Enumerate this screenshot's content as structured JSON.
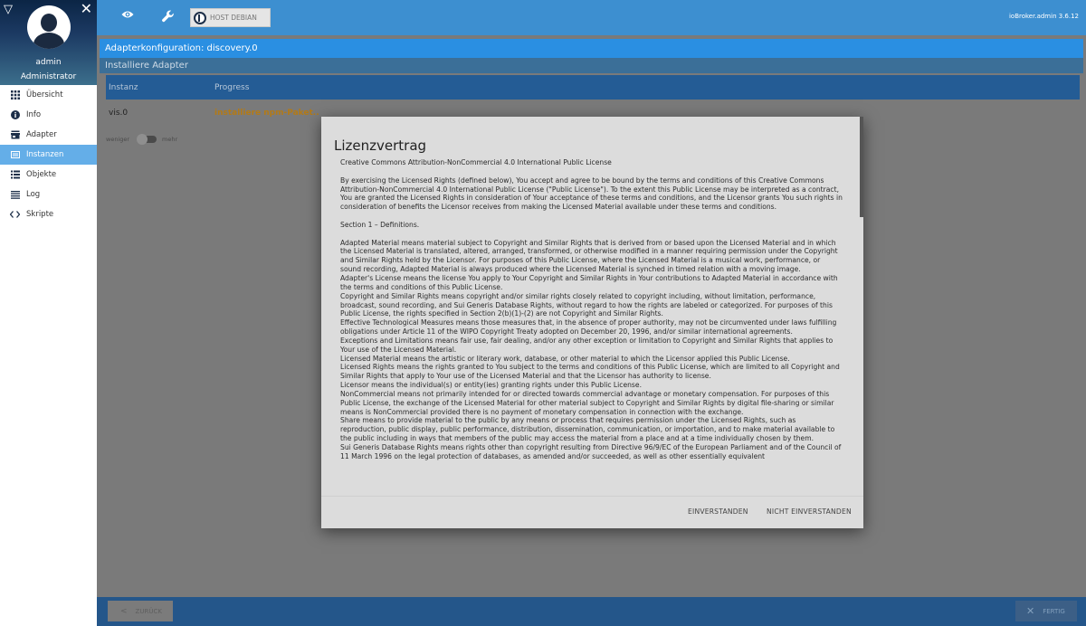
{
  "sidebar": {
    "user_name": "admin",
    "user_role": "Administrator",
    "items": [
      {
        "label": "Übersicht",
        "icon": "grid-icon"
      },
      {
        "label": "Info",
        "icon": "info-icon"
      },
      {
        "label": "Adapter",
        "icon": "store-icon"
      },
      {
        "label": "Instanzen",
        "icon": "instances-icon",
        "active": true
      },
      {
        "label": "Objekte",
        "icon": "objects-icon"
      },
      {
        "label": "Log",
        "icon": "log-icon"
      },
      {
        "label": "Skripte",
        "icon": "code-icon"
      }
    ]
  },
  "topbar": {
    "host_label": "HOST DEBIAN",
    "version": "ioBroker.admin 3.6.12"
  },
  "main": {
    "config_title": "Adapterkonfiguration: discovery.0",
    "install_title": "Installiere Adapter",
    "table": {
      "columns": [
        "Instanz",
        "Progress"
      ],
      "rows": [
        {
          "instance": "vis.0",
          "progress": "installiere npm-Paket.."
        }
      ]
    },
    "toggle": {
      "left": "weniger",
      "right": "mehr"
    },
    "back_label": "ZURÜCK",
    "done_label": "FERTIG"
  },
  "modal": {
    "title": "Lizenzvertrag",
    "paragraphs": [
      "Creative Commons Attribution-NonCommercial 4.0 International Public License",
      "By exercising the Licensed Rights (defined below), You accept and agree to be bound by the terms and conditions of this Creative Commons Attribution-NonCommercial 4.0 International Public License (\"Public License\"). To the extent this Public License may be interpreted as a contract, You are granted the Licensed Rights in consideration of Your acceptance of these terms and conditions, and the Licensor grants You such rights in consideration of benefits the Licensor receives from making the Licensed Material available under these terms and conditions.",
      "Section 1 – Definitions."
    ],
    "definitions": [
      "Adapted Material means material subject to Copyright and Similar Rights that is derived from or based upon the Licensed Material and in which the Licensed Material is translated, altered, arranged, transformed, or otherwise modified in a manner requiring permission under the Copyright and Similar Rights held by the Licensor. For purposes of this Public License, where the Licensed Material is a musical work, performance, or sound recording, Adapted Material is always produced where the Licensed Material is synched in timed relation with a moving image.",
      "Adapter's License means the license You apply to Your Copyright and Similar Rights in Your contributions to Adapted Material in accordance with the terms and conditions of this Public License.",
      "Copyright and Similar Rights means copyright and/or similar rights closely related to copyright including, without limitation, performance, broadcast, sound recording, and Sui Generis Database Rights, without regard to how the rights are labeled or categorized. For purposes of this Public License, the rights specified in Section 2(b)(1)-(2) are not Copyright and Similar Rights.",
      "Effective Technological Measures means those measures that, in the absence of proper authority, may not be circumvented under laws fulfilling obligations under Article 11 of the WIPO Copyright Treaty adopted on December 20, 1996, and/or similar international agreements.",
      "Exceptions and Limitations means fair use, fair dealing, and/or any other exception or limitation to Copyright and Similar Rights that applies to Your use of the Licensed Material.",
      "Licensed Material means the artistic or literary work, database, or other material to which the Licensor applied this Public License.",
      "Licensed Rights means the rights granted to You subject to the terms and conditions of this Public License, which are limited to all Copyright and Similar Rights that apply to Your use of the Licensed Material and that the Licensor has authority to license.",
      "Licensor means the individual(s) or entity(ies) granting rights under this Public License.",
      "NonCommercial means not primarily intended for or directed towards commercial advantage or monetary compensation. For purposes of this Public License, the exchange of the Licensed Material for other material subject to Copyright and Similar Rights by digital file-sharing or similar means is NonCommercial provided there is no payment of monetary compensation in connection with the exchange.",
      "Share means to provide material to the public by any means or process that requires permission under the Licensed Rights, such as reproduction, public display, public performance, distribution, dissemination, communication, or importation, and to make material available to the public including in ways that members of the public may access the material from a place and at a time individually chosen by them.",
      "Sui Generis Database Rights means rights other than copyright resulting from Directive 96/9/EC of the European Parliament and of the Council of 11 March 1996 on the legal protection of databases, as amended and/or succeeded, as well as other essentially equivalent"
    ],
    "agree_label": "EINVERSTANDEN",
    "disagree_label": "NICHT EINVERSTANDEN"
  }
}
